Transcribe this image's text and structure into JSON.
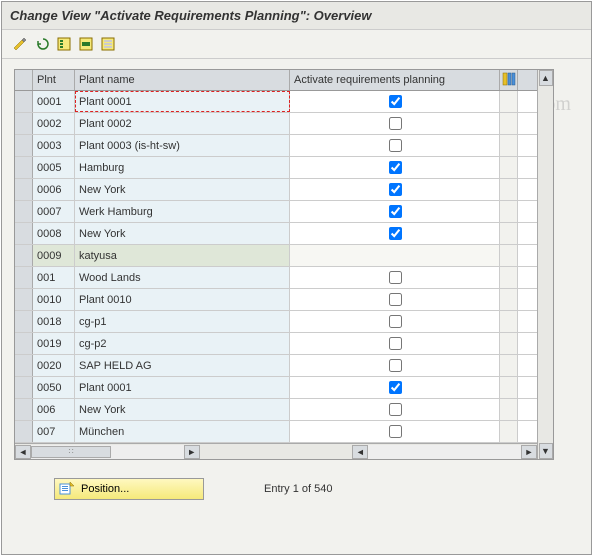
{
  "title": "Change View \"Activate Requirements Planning\": Overview",
  "watermark": "© www.tutorialkart.com",
  "toolbar": {
    "items": [
      {
        "name": "change-icon"
      },
      {
        "name": "undo-icon"
      },
      {
        "name": "select-all-icon"
      },
      {
        "name": "select-block-icon"
      },
      {
        "name": "deselect-all-icon"
      }
    ]
  },
  "columns": {
    "plnt": "Plnt",
    "name": "Plant name",
    "activate": "Activate requirements planning"
  },
  "rows": [
    {
      "plnt": "0001",
      "name": "Plant 0001",
      "checked": true,
      "selected": true
    },
    {
      "plnt": "0002",
      "name": "Plant 0002",
      "checked": false
    },
    {
      "plnt": "0003",
      "name": "Plant 0003 (is-ht-sw)",
      "checked": false
    },
    {
      "plnt": "0005",
      "name": "Hamburg",
      "checked": true
    },
    {
      "plnt": "0006",
      "name": "New York",
      "checked": true
    },
    {
      "plnt": "0007",
      "name": "Werk Hamburg",
      "checked": true
    },
    {
      "plnt": "0008",
      "name": "New York",
      "checked": true
    },
    {
      "plnt": "0009",
      "name": "katyusa",
      "checked": null,
      "alt": true
    },
    {
      "plnt": "001",
      "name": "Wood Lands",
      "checked": false
    },
    {
      "plnt": "0010",
      "name": "Plant 0010",
      "checked": false
    },
    {
      "plnt": "0018",
      "name": "cg-p1",
      "checked": false
    },
    {
      "plnt": "0019",
      "name": "cg-p2",
      "checked": false
    },
    {
      "plnt": "0020",
      "name": "SAP HELD AG",
      "checked": false
    },
    {
      "plnt": "0050",
      "name": "Plant 0001",
      "checked": true
    },
    {
      "plnt": "006",
      "name": "New York",
      "checked": false
    },
    {
      "plnt": "007",
      "name": "München",
      "checked": false
    }
  ],
  "footer": {
    "position_label": "Position...",
    "entry_text": "Entry 1 of 540"
  }
}
